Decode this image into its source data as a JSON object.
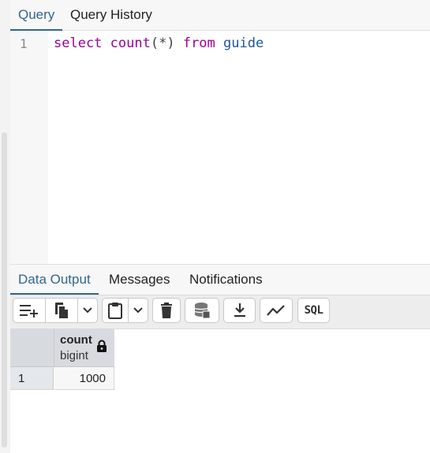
{
  "editor_tabs": [
    "Query",
    "Query History"
  ],
  "editor": {
    "line_number": "1",
    "tokens": {
      "kw1": "select",
      "fn": "count",
      "args": "(*)",
      "kw2": "from",
      "table": "guide"
    }
  },
  "output_tabs": [
    "Data Output",
    "Messages",
    "Notifications"
  ],
  "toolbar": {
    "sql_label": "SQL",
    "icons": [
      "add-row-icon",
      "copy-icon",
      "chevron-down-icon",
      "paste-icon",
      "chevron-down-icon",
      "delete-icon",
      "save-data-icon",
      "download-icon",
      "graph-icon"
    ]
  },
  "grid": {
    "column": {
      "name": "count",
      "type": "bigint"
    },
    "rows": [
      {
        "row_no": "1",
        "value": "1000"
      }
    ]
  },
  "colors": {
    "accent": "#326690",
    "keyword": "#990099",
    "identifier": "#1a56a6"
  }
}
